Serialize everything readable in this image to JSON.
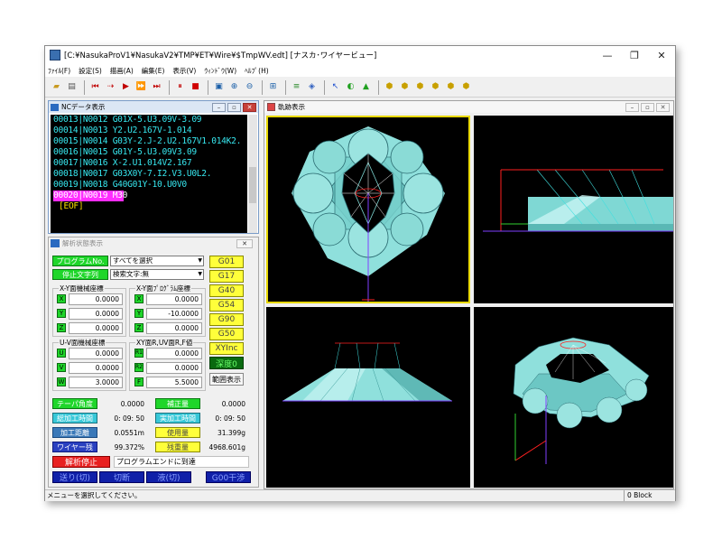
{
  "title": "[C:¥NasukaProV1¥NasukaV2¥TMP¥ET¥Wire¥$TmpWV.edt] [ナスカ･ワイヤービュー]",
  "menu": [
    "ﾌｧｲﾙ(F)",
    "設定(S)",
    "描画(A)",
    "編集(E)",
    "表示(V)",
    "ｳｨﾝﾄﾞｳ(W)",
    "ﾍﾙﾌﾟ(H)"
  ],
  "nc": {
    "title": "NCデータ表示",
    "lines": [
      "00013|N0012 G01X-5.U3.09V-3.09",
      "00014|N0013 Y2.U2.167V-1.014",
      "00015|N0014 G03Y-2.J-2.U2.167V1.014K2.",
      "00016|N0015 G01Y-5.U3.09V3.09",
      "00017|N0016 X-2.U1.014V2.167",
      "00018|N0017 G03X0Y-7.I2.V3.U0L2.",
      "00019|N0018 G40G01Y-10.U0V0"
    ],
    "selected_line": "00020|N0019 M30",
    "eof": "[EOF]"
  },
  "analysis": {
    "title": "解析状態表示",
    "program_no_btn": "プログラムNo.",
    "program_select": "すべてを選択",
    "stop_text_btn": "停止文字列",
    "search_select": "検索文字:無",
    "xy_machine_label": "X-Y面機械座標",
    "xy_program_label": "X-Y面ﾌﾟﾛｸﾞﾗﾑ座標",
    "uv_machine_label": "U-V面機械座標",
    "xy_r_label": "XY面R,UV面R,F値",
    "ax_x": "X",
    "ax_y": "Y",
    "ax_z": "Z",
    "ax_u": "U",
    "ax_v": "V",
    "ax_w": "W",
    "ax_r1": "R1",
    "ax_r2": "R2",
    "ax_f": "F",
    "xm": "0.0000",
    "ym": "0.0000",
    "zm": "0.0000",
    "xp": "0.0000",
    "yp": "-10.0000",
    "zp": "0.0000",
    "um": "0.0000",
    "vm": "0.0000",
    "wm": "3.0000",
    "r1": "0.0000",
    "r2": "0.0000",
    "f": "5.5000",
    "gcodes": [
      "G01",
      "G17",
      "G40",
      "G54",
      "G90",
      "G50"
    ],
    "xy_inc": "XYInc",
    "depth": "深度0",
    "range_btn": "範囲表示",
    "taper_label": "テーパ角度",
    "taper_val": "0.0000",
    "comp_label": "補正量",
    "comp_val": "0.0000",
    "total_time_label": "総加工時間",
    "total_time_val": "0: 09: 50",
    "actual_time_label": "実加工時間",
    "actual_time_val": "0: 09: 50",
    "dist_label": "加工距離",
    "dist_val": "0.0551m",
    "used_label": "使用量",
    "used_val": "31.399g",
    "wire_label": "ワイヤー残",
    "wire_val": "99.372%",
    "remain_label": "残重量",
    "remain_val": "4968.601g",
    "stop_btn": "解析停止",
    "message": "プログラムエンドに到達",
    "feed_btn": "送り(切)",
    "cut_btn": "切断",
    "wait_btn": "液(切)",
    "g00_btn": "G00干渉"
  },
  "trace": {
    "title": "軌跡表示"
  },
  "status": {
    "message": "メニューを選択してください。",
    "block": "0 Block"
  },
  "colors": {
    "solid": "#7ee3e0",
    "nc_text": "#37e8f0",
    "highlight": "#ff2cff"
  }
}
